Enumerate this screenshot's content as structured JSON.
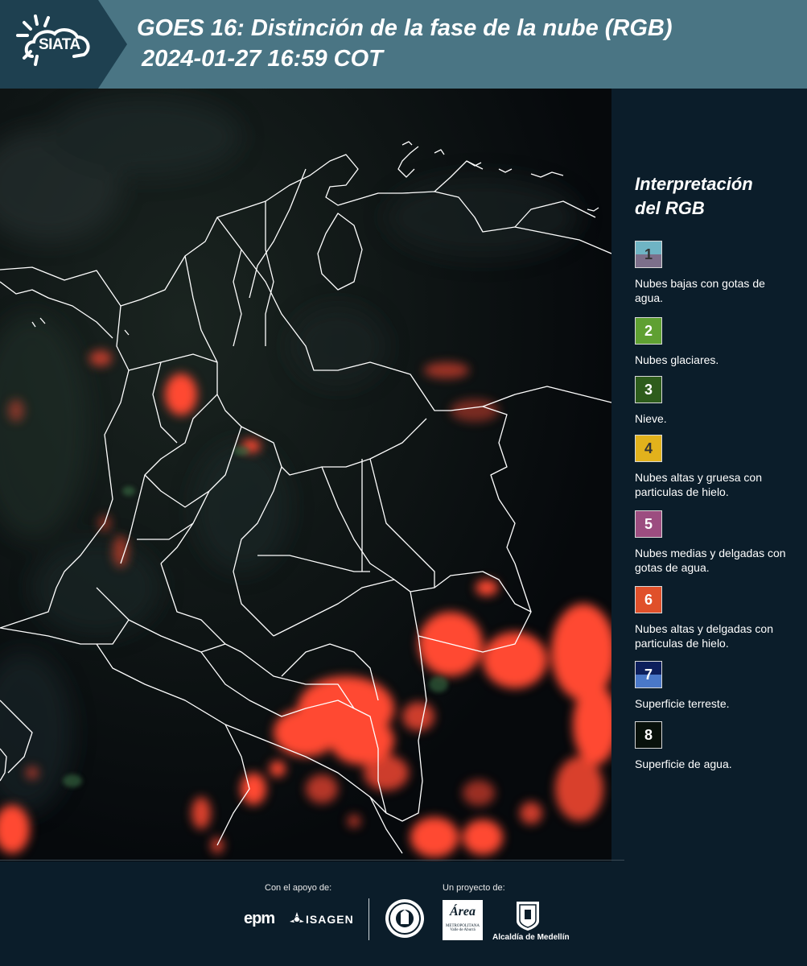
{
  "header": {
    "logo_text": "SIATA",
    "title": "GOES 16: Distinción de la fase de la nube (RGB)",
    "subtitle": "2024-01-27 16:59 COT"
  },
  "legend": {
    "title_line1": "Interpretación",
    "title_line2": "del RGB",
    "items": [
      {
        "num": "1",
        "label": "Nubes bajas con gotas de agua.",
        "color_top": "#6fb4c4",
        "color_bottom": "#7c6f8a",
        "num_color": "#333333"
      },
      {
        "num": "2",
        "label": "Nubes glaciares.",
        "color": "#5fa032",
        "num_color": "#ffffff"
      },
      {
        "num": "3",
        "label": "Nieve.",
        "color": "#2e5c1c",
        "num_color": "#ffffff"
      },
      {
        "num": "4",
        "label": "Nubes altas y gruesa con particulas de hielo.",
        "color": "#e2b21c",
        "num_color": "#333333"
      },
      {
        "num": "5",
        "label": "Nubes medias y delgadas con gotas de agua.",
        "color": "#9c4d80",
        "num_color": "#ffffff"
      },
      {
        "num": "6",
        "label": "Nubes altas y delgadas con particulas de hielo.",
        "color": "#e0502a",
        "num_color": "#ffffff"
      },
      {
        "num": "7",
        "label": "Superficie terreste.",
        "color_top": "#0d1f5c",
        "color_bottom": "#4a78c8",
        "num_color": "#ffffff"
      },
      {
        "num": "8",
        "label": "Superficie de agua.",
        "color": "#08110b",
        "num_color": "#ffffff"
      }
    ]
  },
  "footer": {
    "support_label": "Con el apoyo de:",
    "project_label": "Un proyecto de:",
    "epm_label": "epm",
    "isagen_label": "ISAGEN",
    "area_label": "Área",
    "area_sub1": "METROPOLITANA",
    "area_sub2": "Valle de Aburrá",
    "alcaldia_label": "Alcaldía de Medellín"
  },
  "colors": {
    "header_bg": "#4a7584",
    "page_bg": "#0b1d2a",
    "cloud_ice": "#ff4a32",
    "border_lines": "#ffffff"
  }
}
